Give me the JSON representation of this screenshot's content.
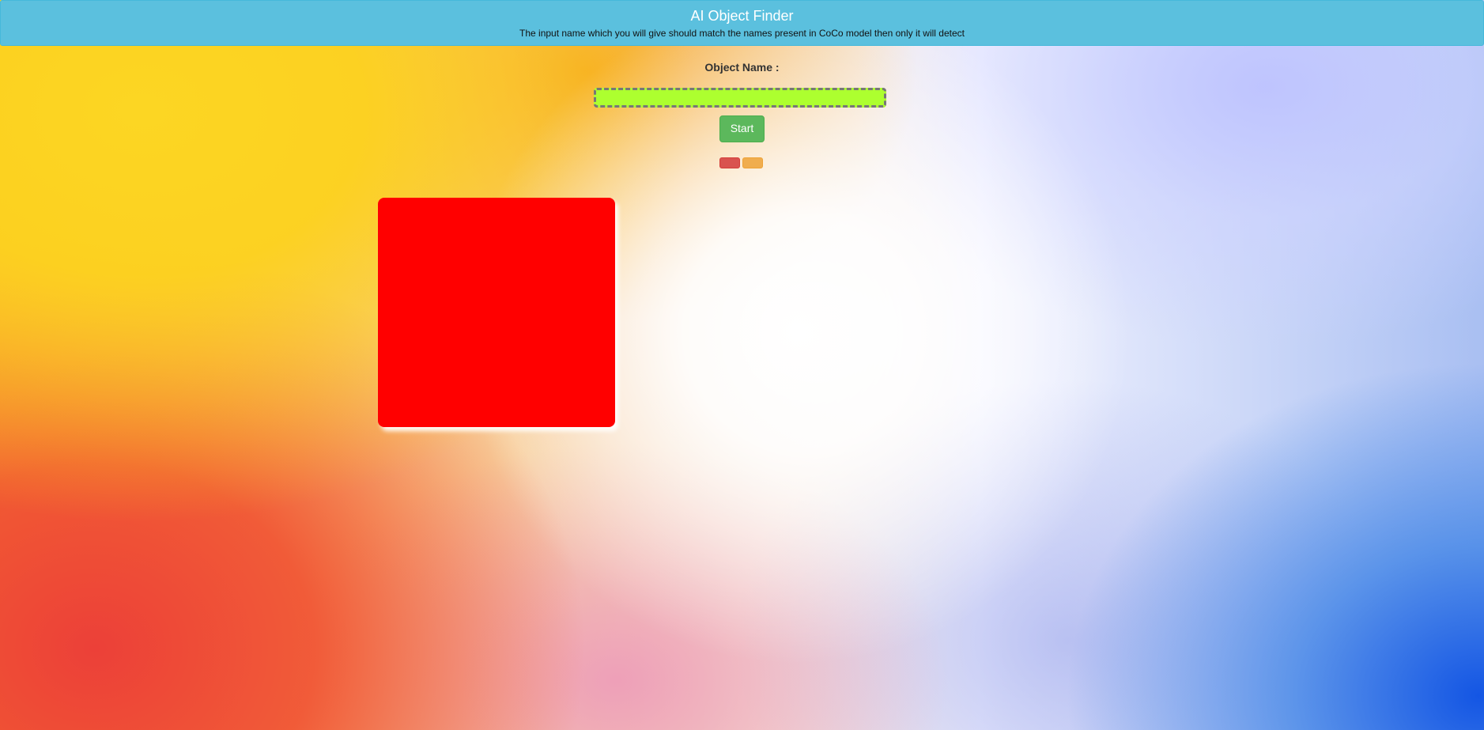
{
  "header": {
    "title": "AI Object Finder",
    "subtitle": "The input name which you will give should match the names present in CoCo model then only it will detect",
    "background_color": "#5bc0de"
  },
  "form": {
    "label": "Object Name :",
    "input_value": "",
    "input_background": "#adff2f",
    "start_label": "Start",
    "start_color": "#5cb85c",
    "small_buttons": [
      {
        "label": "",
        "color": "#d9534f"
      },
      {
        "label": "",
        "color": "#f0ad4e"
      }
    ]
  },
  "video": {
    "fill_color": "#ff0000"
  }
}
